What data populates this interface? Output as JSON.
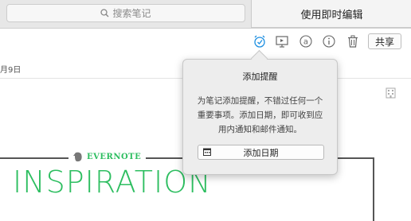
{
  "search": {
    "placeholder": "搜索笔记"
  },
  "toolbar": {
    "inline_edit_label": "使用即时编辑",
    "share_label": "共享",
    "icons": [
      "alarm-clock-icon",
      "presentation-icon",
      "at-sign-icon",
      "info-icon",
      "trash-icon"
    ]
  },
  "note": {
    "date": "月9日",
    "brand": "EVERNOTE",
    "card_title": "INSPIRATION"
  },
  "reminder_popover": {
    "title": "添加提醒",
    "body_lines": [
      "为笔记添加提醒，不错过任何一个",
      "重要事项。添加日期，即可收到应",
      "用内通知和邮件通知。"
    ],
    "add_date_label": "添加日期"
  },
  "colors": {
    "accent_blue": "#1d8fe1",
    "brand_green": "#2dbe60"
  }
}
